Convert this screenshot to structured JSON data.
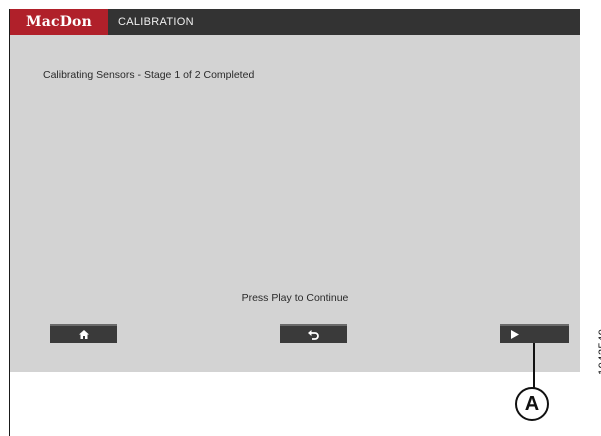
{
  "header": {
    "brand": "MacDon",
    "title": "CALIBRATION"
  },
  "main": {
    "status": "Calibrating Sensors - Stage 1 of 2 Completed",
    "prompt": "Press Play to Continue"
  },
  "buttons": {
    "home_icon": "home-icon",
    "back_icon": "back-icon",
    "play_icon": "play-icon"
  },
  "callout": {
    "label": "A"
  },
  "figure": {
    "number": "1042540"
  },
  "colors": {
    "brand_red": "#b0202a",
    "header_bg": "#333333",
    "screen_bg": "#d3d3d3",
    "button_bg": "#3a3a3a"
  }
}
